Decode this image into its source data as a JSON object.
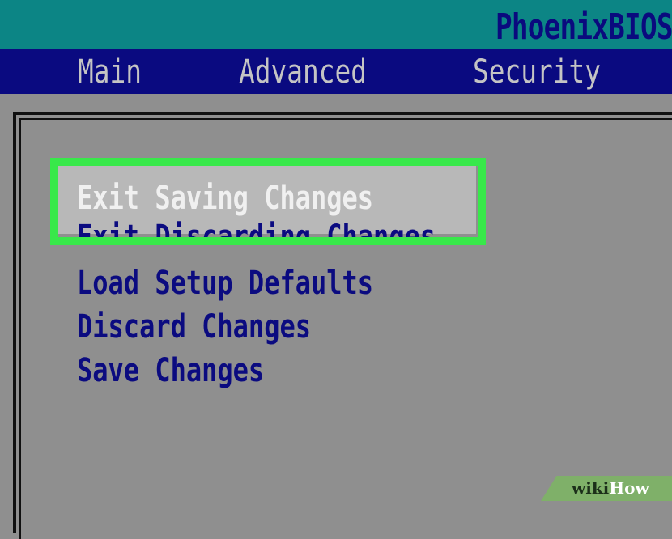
{
  "header": {
    "brand": "PhoenixBIOS"
  },
  "menu": {
    "items": [
      "Main",
      "Advanced",
      "Security"
    ]
  },
  "exit_menu": {
    "options": [
      "Exit Saving Changes",
      "Exit Discarding Changes",
      "Load Setup Defaults",
      "Discard Changes",
      "Save Changes"
    ],
    "selected_index": 0
  },
  "watermark": {
    "prefix": "wiki",
    "suffix": "How"
  },
  "colors": {
    "title_bar": "#0c8585",
    "menu_bar": "#0a0a80",
    "panel": "#8f8f8f",
    "highlight_border": "#38e84a"
  }
}
